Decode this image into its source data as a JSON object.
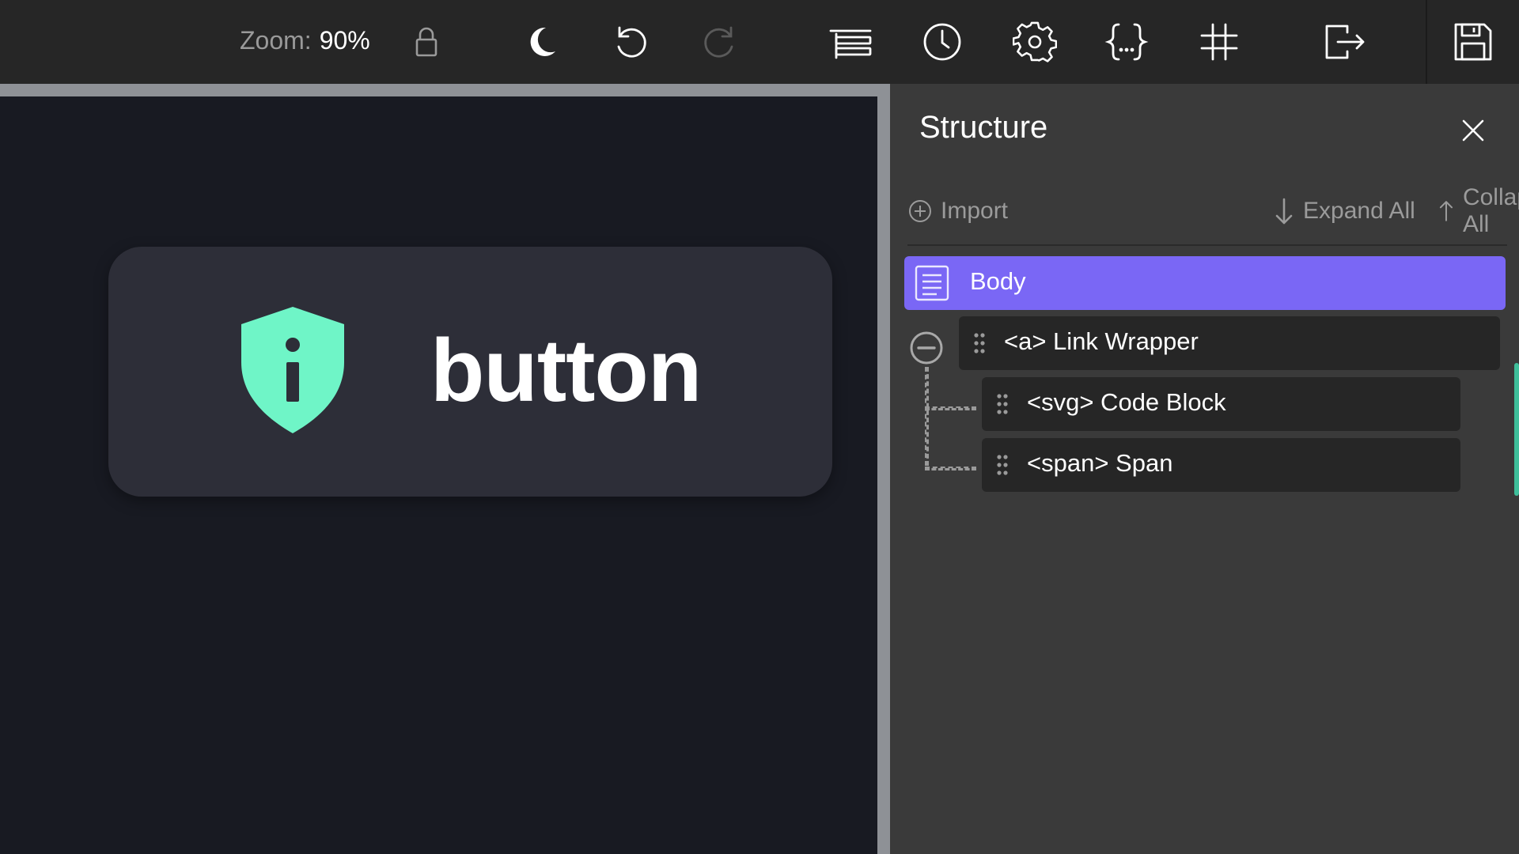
{
  "toolbar": {
    "zoom_label": "Zoom:",
    "zoom_value": "90%",
    "icons": [
      "lock-icon",
      "moon-icon",
      "undo-icon",
      "redo-icon",
      "navigator-icon",
      "history-icon",
      "settings-icon",
      "code-icon",
      "grid-icon",
      "export-icon",
      "save-icon"
    ]
  },
  "canvas": {
    "button_label": "button",
    "shield_color": "#6ff5c7"
  },
  "panel": {
    "title": "Structure",
    "import_label": "Import",
    "expand_label": "Expand All",
    "collapse_label": "Collapse All",
    "tree": {
      "root_label": "Body",
      "children": [
        {
          "label": "<a> Link Wrapper"
        },
        {
          "label": "<svg> Code Block"
        },
        {
          "label": "<span> Span"
        }
      ]
    },
    "accent_color": "#7a67f5"
  }
}
